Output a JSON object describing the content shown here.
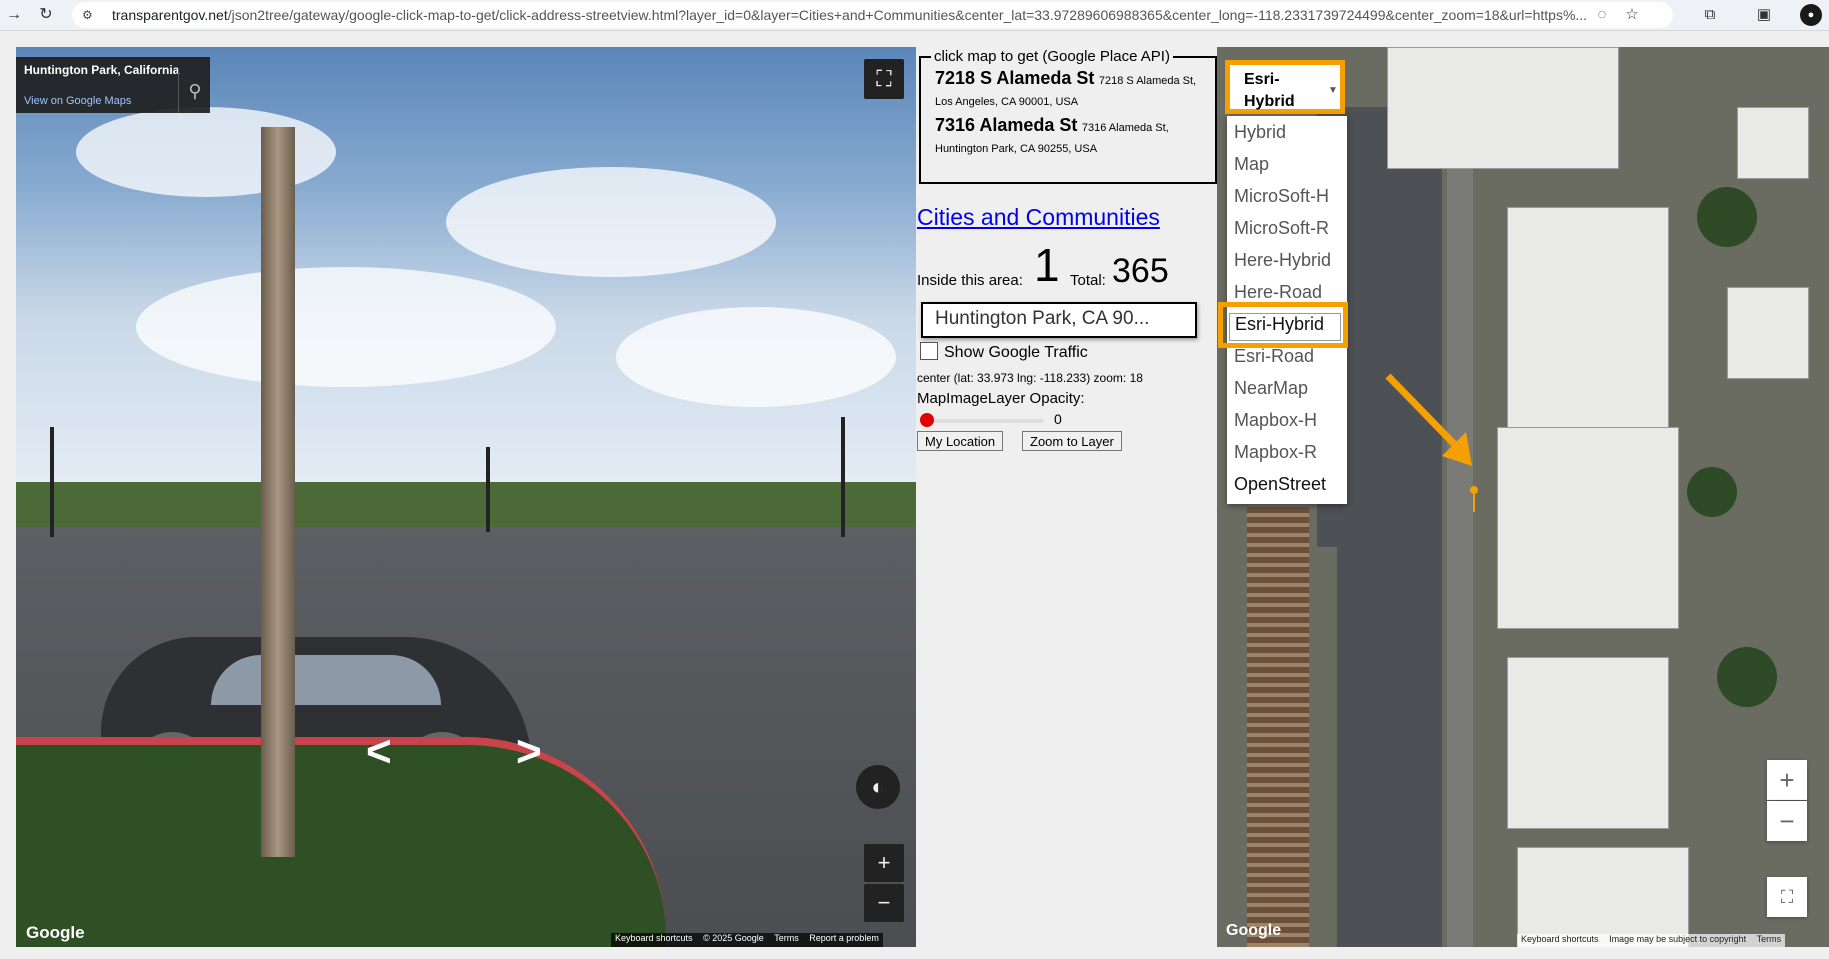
{
  "browser": {
    "url_domain": "transparentgov.net",
    "url_path": "/json2tree/gateway/google-click-map-to-get/click-address-streetview.html?layer_id=0&layer=Cities+and+Communities&center_lat=33.97289606988365&center_long=-118.2331739724499&center_zoom=18&url=https%..."
  },
  "streetview": {
    "location_title": "Huntington Park, California",
    "view_link": "View on Google Maps",
    "logo": "Google",
    "footer": [
      "Keyboard shortcuts",
      "© 2025 Google",
      "Terms",
      "Report a problem"
    ],
    "zoom_in": "+",
    "zoom_out": "−"
  },
  "place_api": {
    "legend": "click map to get (Google Place API)",
    "results": [
      {
        "name": "7218 S Alameda St",
        "address": "7218 S Alameda St, Los Angeles, CA 90001, USA"
      },
      {
        "name": "7316 Alameda St",
        "address": "7316 Alameda St, Huntington Park, CA 90255, USA"
      }
    ]
  },
  "layer": {
    "name": "Cities and Communities",
    "inside_label": "Inside this area:",
    "inside_count": "1",
    "total_label": "Total:",
    "total_count": "365"
  },
  "search": {
    "value": "Huntington Park, CA 90..."
  },
  "traffic_label": "Show Google Traffic",
  "center_text": "center (lat: 33.973 lng: -118.233) zoom: 18",
  "opacity": {
    "label": "MapImageLayer Opacity:",
    "value": "0",
    "fraction": 0
  },
  "buttons": {
    "my_location": "My Location",
    "zoom_to_layer": "Zoom to Layer"
  },
  "basemap": {
    "selected": "Esri-Hybrid",
    "options": [
      "Hybrid",
      "Map",
      "MicroSoft-H",
      "MicroSoft-R",
      "Here-Hybrid",
      "Here-Road",
      "Esri-Hybrid",
      "Esri-Road",
      "NearMap",
      "Mapbox-H",
      "Mapbox-R",
      "OpenStreet"
    ]
  },
  "map": {
    "logo": "Google",
    "footer": [
      "Keyboard shortcuts",
      "Image may be subject to copyright",
      "Terms"
    ],
    "zoom_in": "+",
    "zoom_out": "−"
  },
  "colors": {
    "highlight": "#f5a000",
    "link": "#0000ee",
    "slider_knob": "#e00000"
  },
  "icons": [
    "reload-icon",
    "back-icon",
    "site-info-icon",
    "fullscreen-icon",
    "map-pin-icon",
    "compass-icon",
    "extensions-icon",
    "star-icon",
    "eye-off-icon"
  ]
}
